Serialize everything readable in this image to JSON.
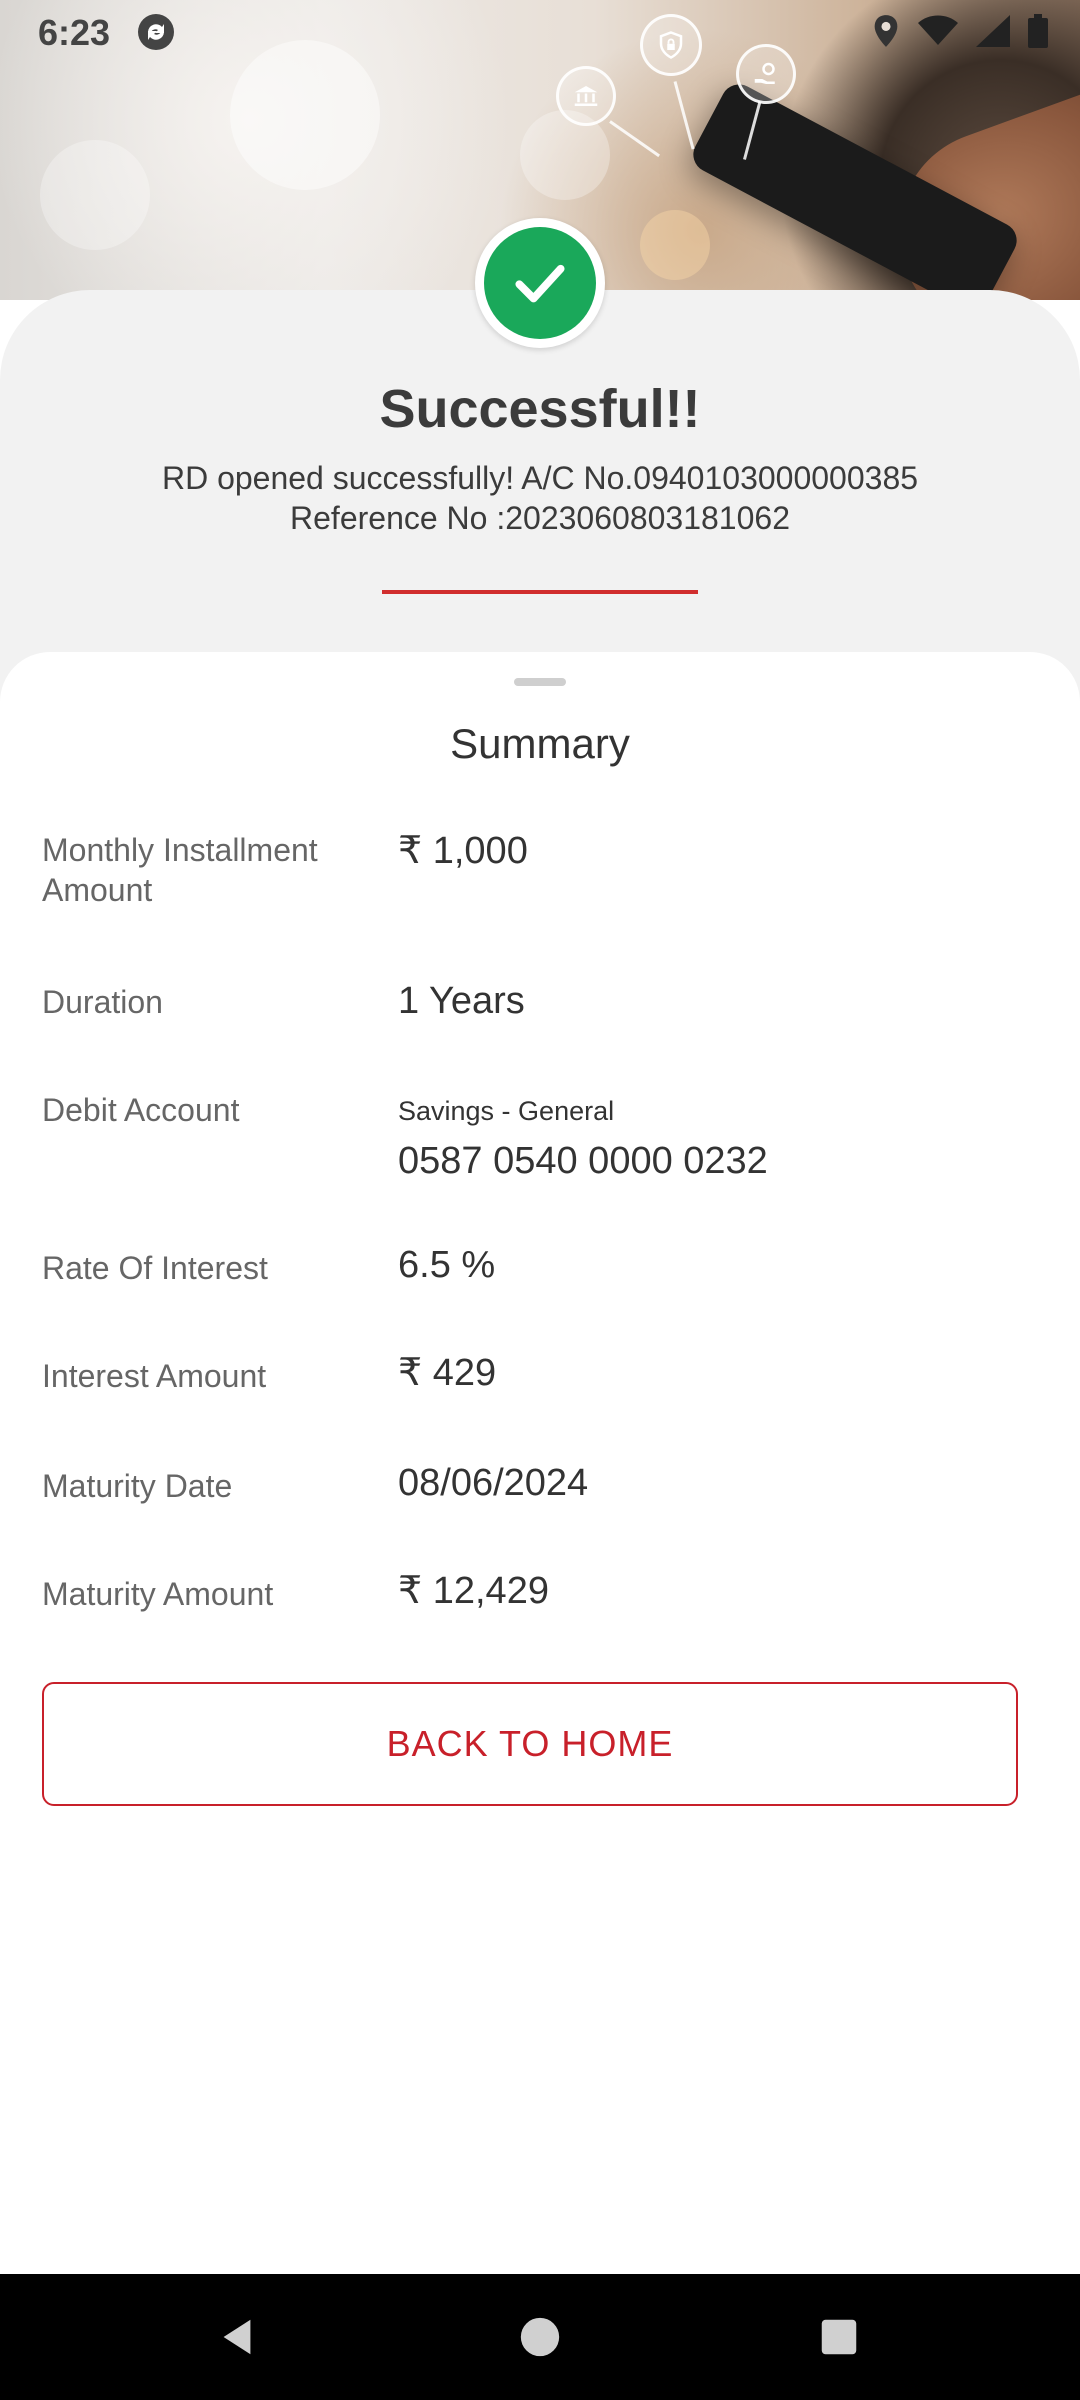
{
  "status_bar": {
    "time": "6:23"
  },
  "success": {
    "title": "Successful!!",
    "message": "RD opened successfully! A/C No.0940103000000385",
    "reference": "Reference No :2023060803181062"
  },
  "summary": {
    "title": "Summary",
    "rows": [
      {
        "label": "Monthly Installment Amount",
        "value": "₹ 1,000"
      },
      {
        "label": "Duration",
        "value": "1 Years"
      },
      {
        "label": "Debit Account",
        "sub": "Savings - General",
        "value": "0587 0540 0000 0232"
      },
      {
        "label": "Rate Of Interest",
        "value": "6.5 %"
      },
      {
        "label": "Interest Amount",
        "value": "₹ 429"
      },
      {
        "label": "Maturity Date",
        "value": "08/06/2024"
      },
      {
        "label": "Maturity Amount",
        "value": "₹ 12,429"
      }
    ]
  },
  "actions": {
    "back_home_label": "BACK TO HOME"
  },
  "colors": {
    "success_green": "#1aa85a",
    "accent_red": "#c8202a",
    "card_grey": "#f2f2f2"
  },
  "icons": [
    "sync-icon",
    "location-icon",
    "wifi-icon",
    "signal-icon",
    "battery-icon",
    "checkmark-icon",
    "bank-icon",
    "shield-lock-icon",
    "hand-coin-icon",
    "back-nav-icon",
    "home-nav-icon",
    "recents-nav-icon"
  ]
}
